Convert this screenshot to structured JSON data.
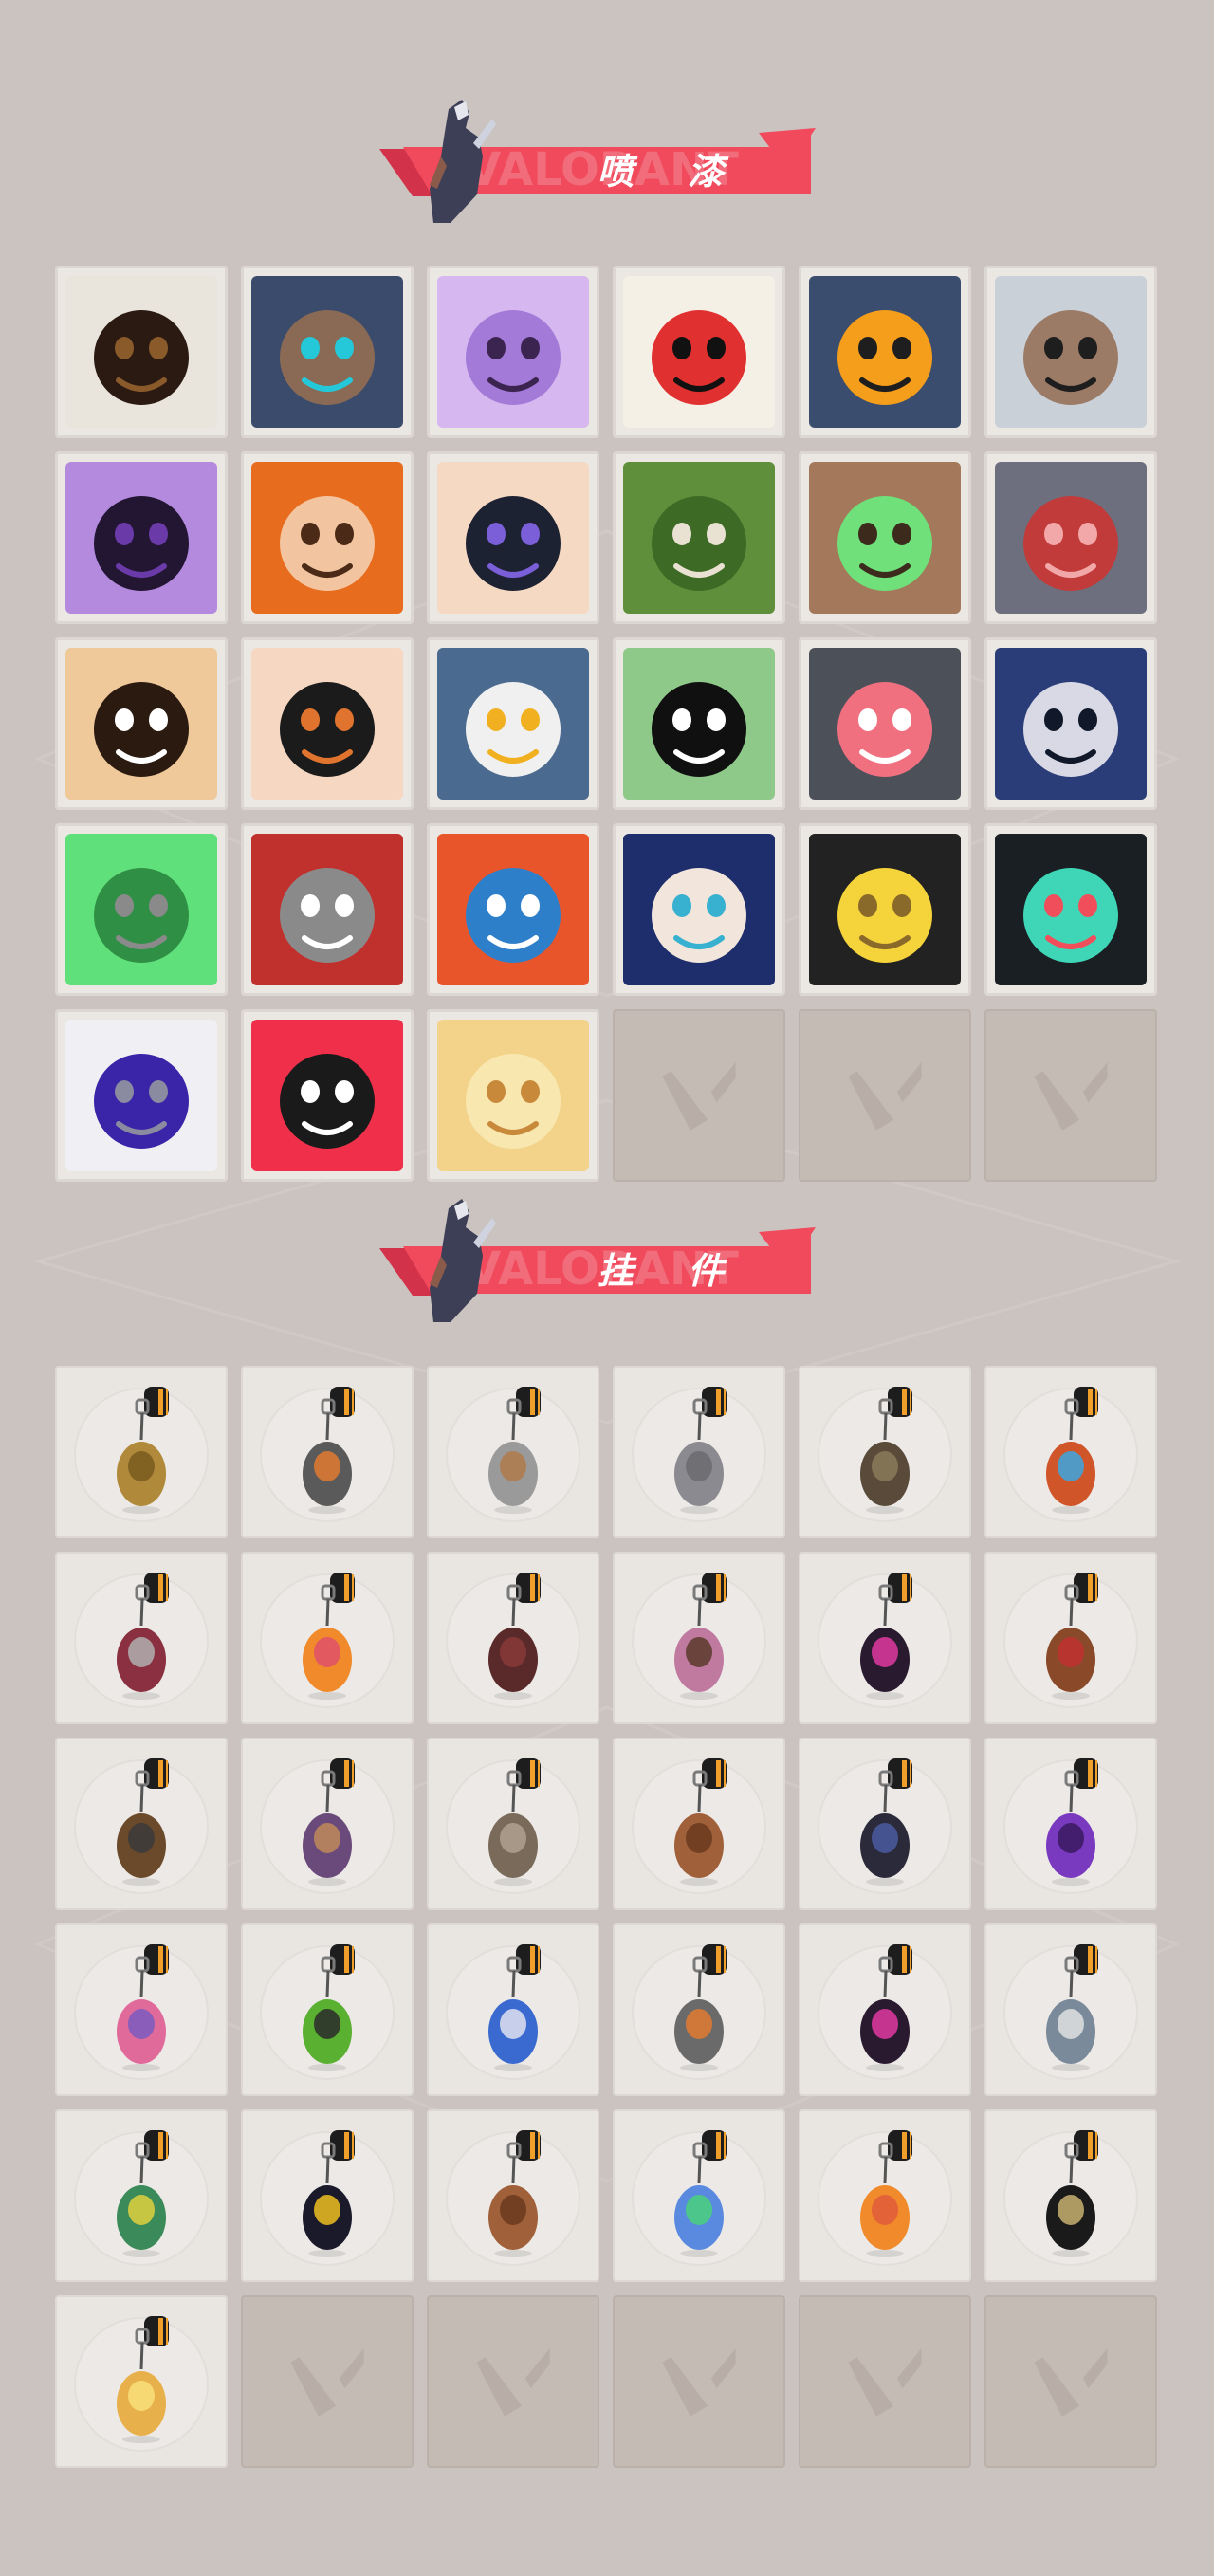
{
  "sections": [
    {
      "id": "sprays",
      "title": "喷 漆",
      "watermark": "VALORANT",
      "items": [
        {
          "icon": "spray-pixel-agent-icon",
          "colors": [
            "#e9e4dc",
            "#2a1a12",
            "#8b5a2b"
          ]
        },
        {
          "icon": "spray-robot-helmet-icon",
          "colors": [
            "#3b4b6b",
            "#8a6a55",
            "#24c8d8"
          ]
        },
        {
          "icon": "spray-purple-ghost-icon",
          "colors": [
            "#d7b7f0",
            "#a47ad8",
            "#3c2450"
          ]
        },
        {
          "icon": "spray-clown-face-icon",
          "colors": [
            "#f4f0e6",
            "#e03030",
            "#111111"
          ]
        },
        {
          "icon": "spray-orange-hat-icon",
          "colors": [
            "#3a4d6e",
            "#f59e1b",
            "#1e1e1e"
          ]
        },
        {
          "icon": "spray-cool-bear-icon",
          "colors": [
            "#c9d0d8",
            "#9b7b66",
            "#1e1e1e"
          ]
        },
        {
          "icon": "spray-dark-portal-icon",
          "colors": [
            "#b48adf",
            "#231633",
            "#6a3aa8"
          ]
        },
        {
          "icon": "spray-grinning-man-icon",
          "colors": [
            "#e86c1e",
            "#f2c5a0",
            "#4b2a18"
          ]
        },
        {
          "icon": "spray-anime-boy-icon",
          "colors": [
            "#f5d9c2",
            "#1d2233",
            "#7a5fd8"
          ]
        },
        {
          "icon": "spray-green-crate-icon",
          "colors": [
            "#5f8f3a",
            "#3d6a25",
            "#e9e1d2"
          ]
        },
        {
          "icon": "spray-glowing-eyes-icon",
          "colors": [
            "#a4785a",
            "#6fe07a",
            "#3c2a1c"
          ]
        },
        {
          "icon": "spray-crying-seal-icon",
          "colors": [
            "#6d6f7e",
            "#c23b3b",
            "#f2a8a8"
          ]
        },
        {
          "icon": "spray-tiger-icon",
          "colors": [
            "#f0c99a",
            "#2a1a10",
            "#ffffff"
          ]
        },
        {
          "icon": "spray-angry-girl-icon",
          "colors": [
            "#f5d7c2",
            "#1b1b1b",
            "#e0742e"
          ]
        },
        {
          "icon": "spray-beanie-penguin-icon",
          "colors": [
            "#4a6a8f",
            "#f0f0f0",
            "#f0b020"
          ]
        },
        {
          "icon": "spray-frog-hat-icon",
          "colors": [
            "#8fc98a",
            "#101010",
            "#ffffff"
          ]
        },
        {
          "icon": "spray-grey-cat-icon",
          "colors": [
            "#4c5059",
            "#f07080",
            "#ffffff"
          ]
        },
        {
          "icon": "spray-hooded-agent-icon",
          "colors": [
            "#2a3d78",
            "#d9d9e6",
            "#101829"
          ]
        },
        {
          "icon": "spray-green-slime-icon",
          "colors": [
            "#5fe07a",
            "#2f8f45",
            "#8a8a8a"
          ]
        },
        {
          "icon": "spray-red-x-button-icon",
          "colors": [
            "#c0302c",
            "#8a8a8a",
            "#ffffff"
          ]
        },
        {
          "icon": "spray-koi-fish-icon",
          "colors": [
            "#e9552b",
            "#2e7fc9",
            "#ffffff"
          ]
        },
        {
          "icon": "spray-sword-woman-icon",
          "colors": [
            "#1e2d6b",
            "#f2e6dc",
            "#38b0d0"
          ]
        },
        {
          "icon": "spray-pistol-duck-icon",
          "colors": [
            "#222222",
            "#f5d33a",
            "#8a6a2a"
          ]
        },
        {
          "icon": "spray-valorant-logo-icon",
          "colors": [
            "#1a1f24",
            "#3fd6b8",
            "#f04e5a"
          ]
        },
        {
          "icon": "spray-graffiti-tag-icon",
          "colors": [
            "#f0f0f4",
            "#3a24a8",
            "#8a8aa0"
          ]
        },
        {
          "icon": "spray-red-v-logo-icon",
          "colors": [
            "#f0304a",
            "#1a1a1a",
            "#ffffff"
          ]
        },
        {
          "icon": "spray-yellow-star-icon",
          "colors": [
            "#f3d38a",
            "#f9e7b0",
            "#c88a3a"
          ]
        },
        {
          "icon": "empty-slot-v-logo-icon",
          "empty": true
        },
        {
          "icon": "empty-slot-v-logo-icon",
          "empty": true
        },
        {
          "icon": "empty-slot-v-logo-icon",
          "empty": true
        }
      ]
    },
    {
      "id": "charms",
      "title": "挂 件",
      "watermark": "VALORANT",
      "items": [
        {
          "icon": "charm-golden-cat-icon",
          "colors": [
            "#b08a3a",
            "#7a5a20"
          ]
        },
        {
          "icon": "charm-drone-robot-icon",
          "colors": [
            "#5a5a5a",
            "#e07a30"
          ]
        },
        {
          "icon": "charm-dumpster-bear-icon",
          "colors": [
            "#9a9a9a",
            "#b07a4a"
          ]
        },
        {
          "icon": "charm-raccoon-icon",
          "colors": [
            "#8a8a90",
            "#6a6a70"
          ]
        },
        {
          "icon": "charm-spiked-ball-icon",
          "colors": [
            "#5a4a3a",
            "#8a7a5a"
          ]
        },
        {
          "icon": "charm-energy-canister-icon",
          "colors": [
            "#d0562a",
            "#3aa6e0"
          ]
        },
        {
          "icon": "charm-spiked-sword-icon",
          "colors": [
            "#8a3040",
            "#b0b0b0"
          ]
        },
        {
          "icon": "charm-orange-bird-icon",
          "colors": [
            "#f08a2a",
            "#e0506a"
          ]
        },
        {
          "icon": "charm-rope-knot-icon",
          "colors": [
            "#5a2a2a",
            "#8a3a3a"
          ]
        },
        {
          "icon": "charm-cupcake-icon",
          "colors": [
            "#c07aa0",
            "#5a3a2a"
          ]
        },
        {
          "icon": "charm-ep9-badge-icon",
          "colors": [
            "#2a1a30",
            "#e03aa0"
          ]
        },
        {
          "icon": "charm-boxing-bear-icon",
          "colors": [
            "#8a4a2a",
            "#c03030"
          ]
        },
        {
          "icon": "charm-camera-gadget-icon",
          "colors": [
            "#6a4a2a",
            "#3a3a3a"
          ]
        },
        {
          "icon": "charm-agent-figure-icon",
          "colors": [
            "#6a4a7a",
            "#c08a5a"
          ]
        },
        {
          "icon": "charm-cowboy-robot-icon",
          "colors": [
            "#7a6a5a",
            "#b0a090"
          ]
        },
        {
          "icon": "charm-supply-crate-icon",
          "colors": [
            "#a0603a",
            "#6a3a20"
          ]
        },
        {
          "icon": "charm-dark-creature-icon",
          "colors": [
            "#2a2a3a",
            "#4a5aa0"
          ]
        },
        {
          "icon": "charm-purple-crystal-icon",
          "colors": [
            "#7a3ac0",
            "#3a1a60"
          ]
        },
        {
          "icon": "charm-lava-lamp-icon",
          "colors": [
            "#e06a9a",
            "#7a5ac0"
          ]
        },
        {
          "icon": "charm-green-pager-icon",
          "colors": [
            "#5ab030",
            "#2a2a2a"
          ]
        },
        {
          "icon": "charm-astronaut-icon",
          "colors": [
            "#3a6ad0",
            "#e0e0f0"
          ]
        },
        {
          "icon": "charm-radio-device-icon",
          "colors": [
            "#6a6a6a",
            "#e07a30"
          ]
        },
        {
          "icon": "charm-ep9-badge-icon",
          "colors": [
            "#2a1a30",
            "#e03aa0"
          ]
        },
        {
          "icon": "charm-agent-portrait-icon",
          "colors": [
            "#7a8a9a",
            "#e0e0e0"
          ]
        },
        {
          "icon": "charm-soda-can-icon",
          "colors": [
            "#3a8a5a",
            "#e0d040"
          ]
        },
        {
          "icon": "charm-ep9-badge-icon",
          "colors": [
            "#1a1a2a",
            "#f0c020"
          ]
        },
        {
          "icon": "charm-pretzel-icon",
          "colors": [
            "#a0603a",
            "#6a3a20"
          ]
        },
        {
          "icon": "charm-ufo-icon",
          "colors": [
            "#5a8ae0",
            "#4ad07a"
          ]
        },
        {
          "icon": "charm-orange-cat-icon",
          "colors": [
            "#f08a2a",
            "#e05a3a"
          ]
        },
        {
          "icon": "charm-valorant-coin-icon",
          "colors": [
            "#1a1a1a",
            "#c8b070"
          ]
        },
        {
          "icon": "charm-golden-egg-icon",
          "colors": [
            "#e8b04a",
            "#f8e07a"
          ]
        },
        {
          "icon": "empty-slot-v-logo-icon",
          "empty": true
        },
        {
          "icon": "empty-slot-v-logo-icon",
          "empty": true
        },
        {
          "icon": "empty-slot-v-logo-icon",
          "empty": true
        },
        {
          "icon": "empty-slot-v-logo-icon",
          "empty": true
        },
        {
          "icon": "empty-slot-v-logo-icon",
          "empty": true
        }
      ]
    }
  ],
  "theme": {
    "background": "#cbc3bf",
    "banner_red": "#f04a5c",
    "banner_dark": "#d2334a"
  }
}
